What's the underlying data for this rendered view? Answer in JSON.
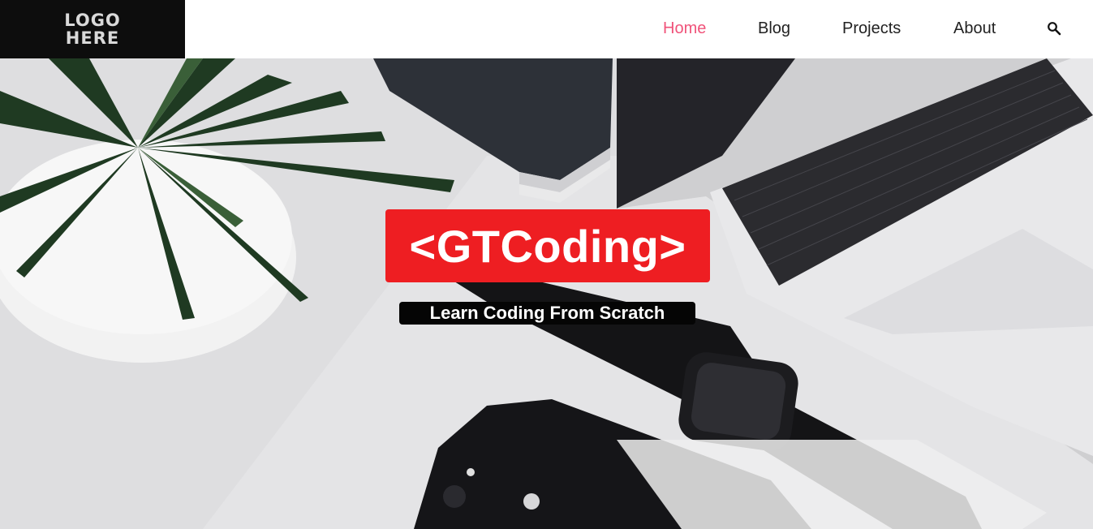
{
  "header": {
    "logo": {
      "line1": "LOGO",
      "line2": "HERE"
    },
    "nav": {
      "home": "Home",
      "blog": "Blog",
      "projects": "Projects",
      "about": "About"
    },
    "active_color": "#f0537a",
    "search_icon": "search-icon"
  },
  "hero": {
    "title": "<GTCoding>",
    "subtitle": "Learn Coding From Scratch",
    "title_bg": "#ee1e22",
    "subtitle_bg": "#050505"
  }
}
